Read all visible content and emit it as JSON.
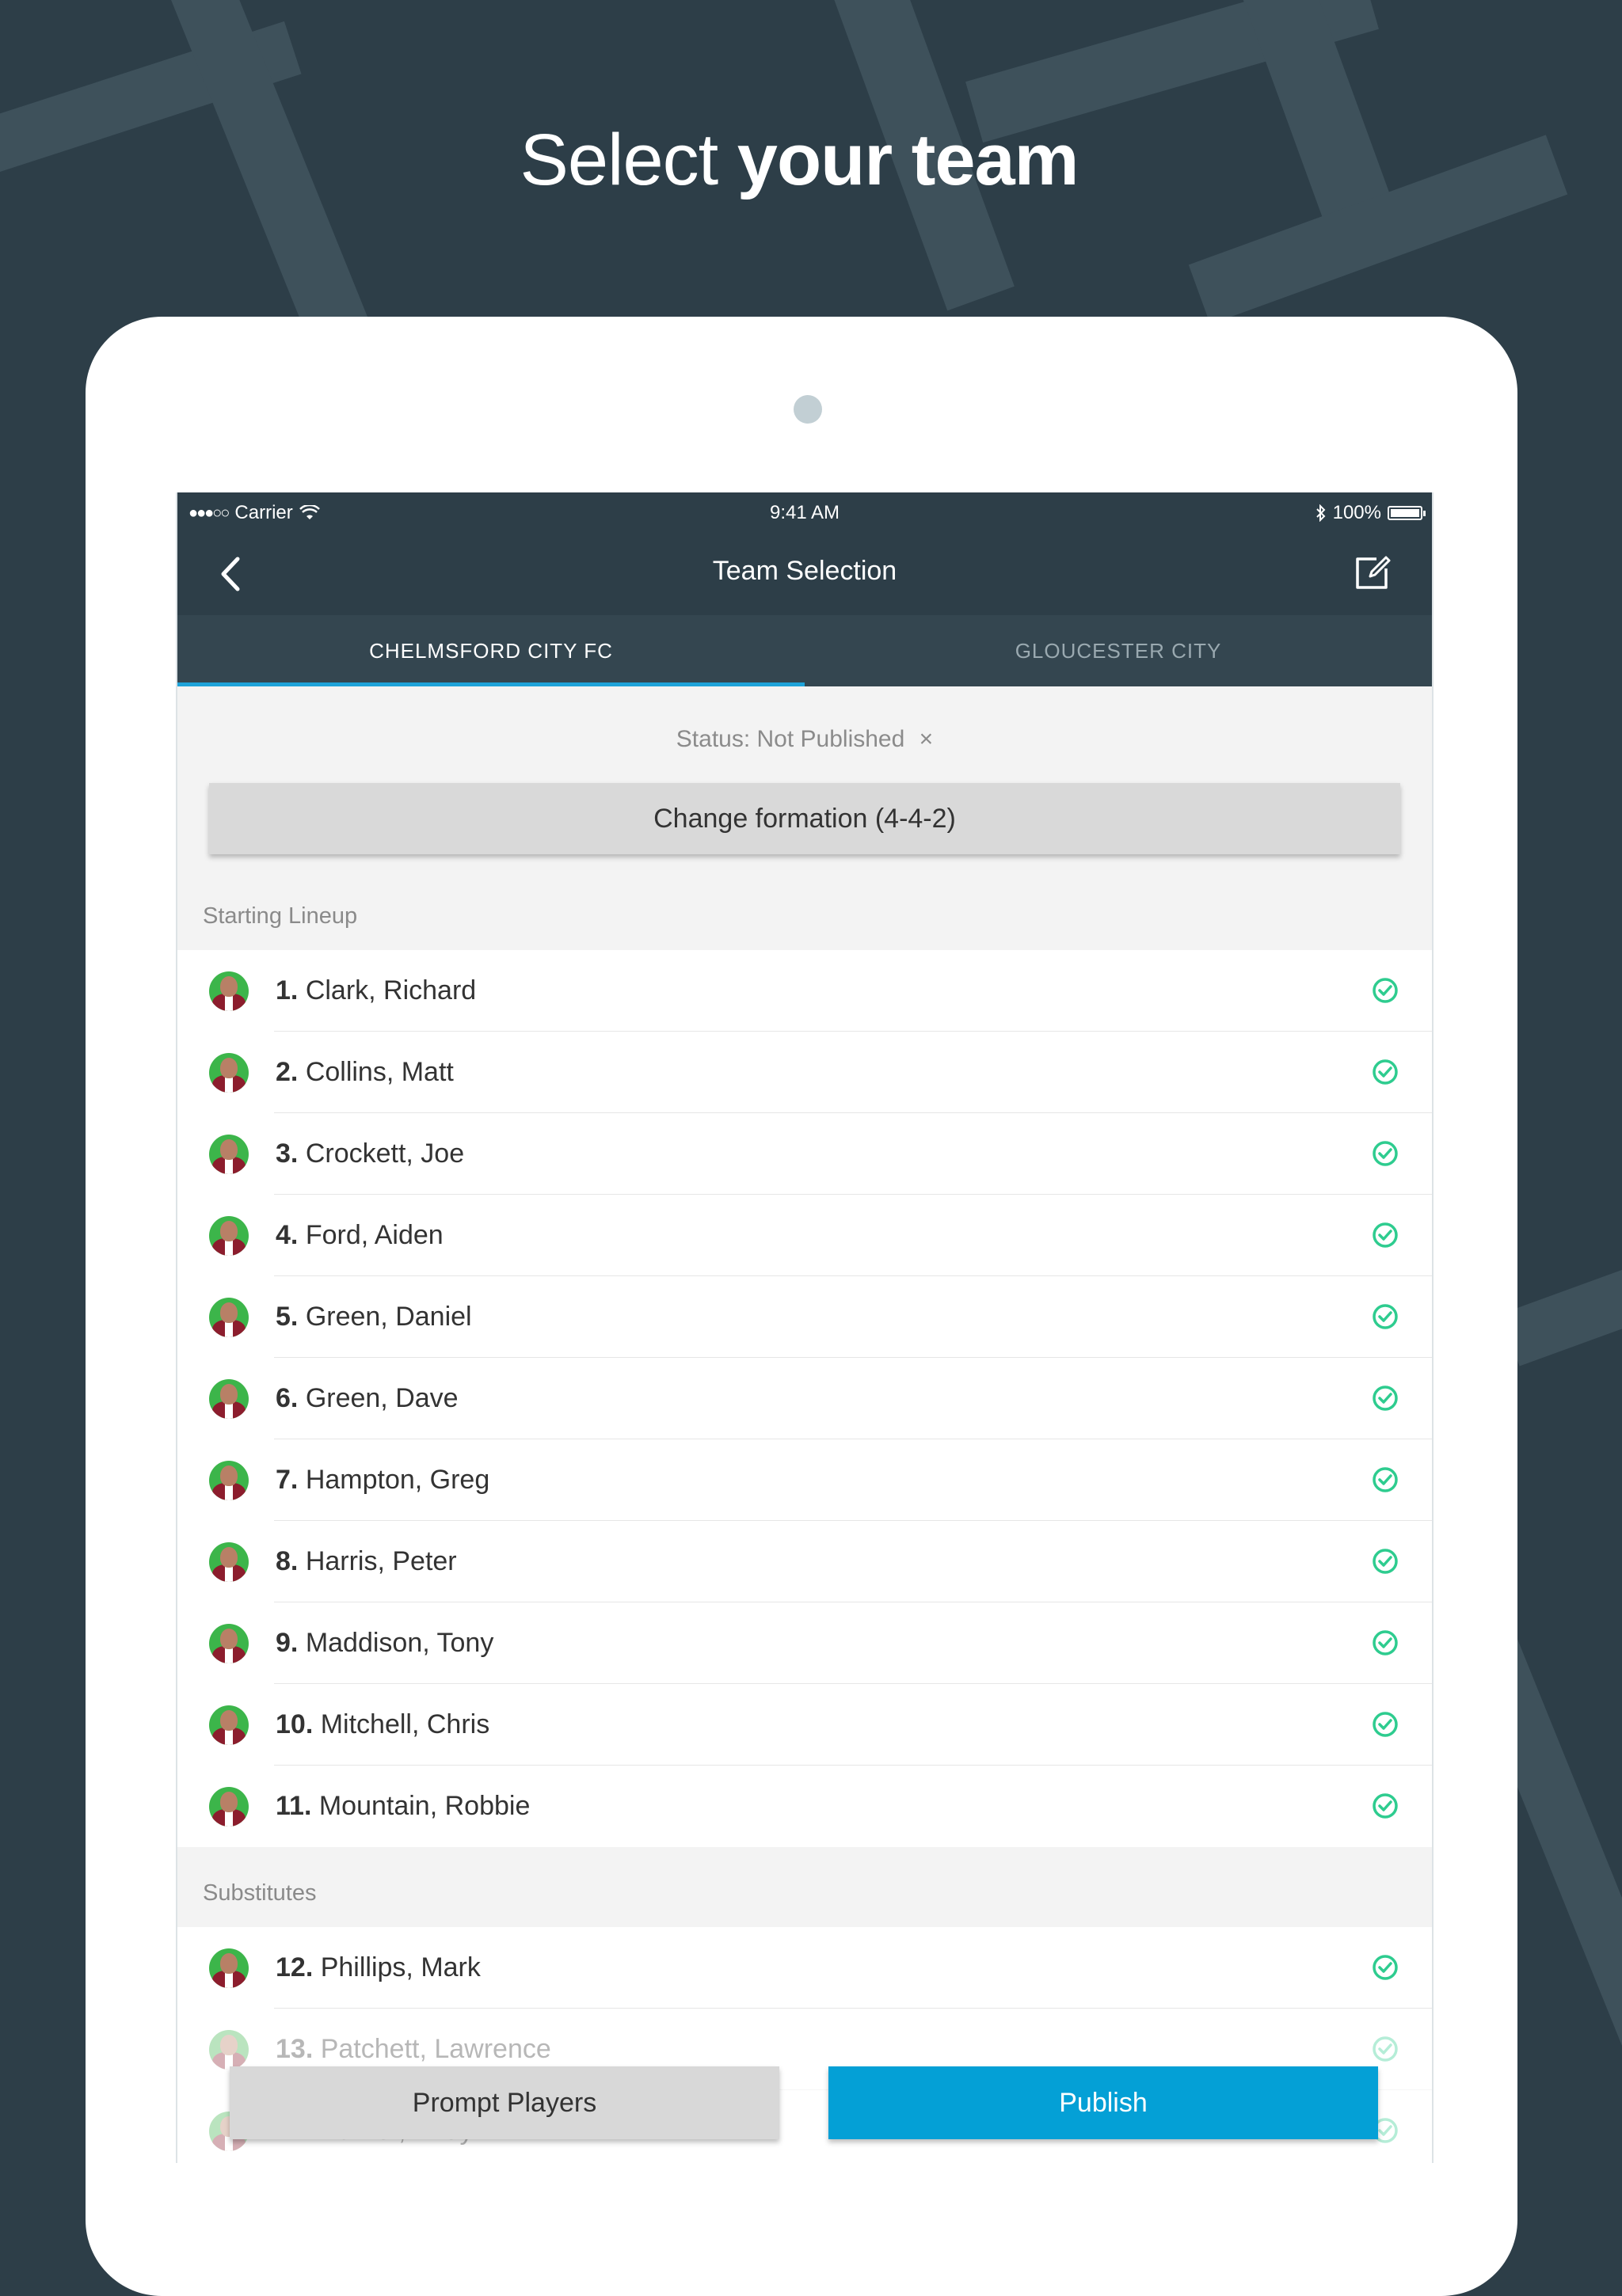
{
  "headline": {
    "light": "Select ",
    "bold": "your team"
  },
  "statusbar": {
    "carrier": "Carrier",
    "time": "9:41 AM",
    "battery": "100%"
  },
  "navbar": {
    "title": "Team Selection",
    "back_icon": "chevron-left-icon",
    "edit_icon": "edit-icon"
  },
  "tabs": [
    {
      "label": "CHELMSFORD CITY FC",
      "active": true
    },
    {
      "label": "GLOUCESTER CITY",
      "active": false
    }
  ],
  "status": {
    "text": "Status: Not Published",
    "close": "×"
  },
  "formation_button": "Change formation (4-4-2)",
  "starting": {
    "header": "Starting Lineup",
    "players": [
      {
        "num": "1.",
        "name": "Clark, Richard"
      },
      {
        "num": "2.",
        "name": "Collins, Matt"
      },
      {
        "num": "3.",
        "name": "Crockett, Joe"
      },
      {
        "num": "4.",
        "name": "Ford, Aiden"
      },
      {
        "num": "5.",
        "name": "Green, Daniel"
      },
      {
        "num": "6.",
        "name": "Green, Dave"
      },
      {
        "num": "7.",
        "name": "Hampton, Greg"
      },
      {
        "num": "8.",
        "name": "Harris, Peter"
      },
      {
        "num": "9.",
        "name": "Maddison, Tony"
      },
      {
        "num": "10.",
        "name": "Mitchell, Chris"
      },
      {
        "num": "11.",
        "name": "Mountain, Robbie"
      }
    ]
  },
  "substitutes": {
    "header": "Substitutes",
    "players": [
      {
        "num": "12.",
        "name": "Phillips, Mark"
      },
      {
        "num": "13.",
        "name": "Patchett, Lawrence"
      },
      {
        "num": "14.",
        "name": "Parker, Andy"
      }
    ]
  },
  "actions": {
    "prompt": "Prompt Players",
    "publish": "Publish"
  },
  "colors": {
    "background": "#2d3e48",
    "accent": "#04a0d6",
    "check": "#2ecc8f",
    "tab_indicator": "#1ea3d9"
  }
}
